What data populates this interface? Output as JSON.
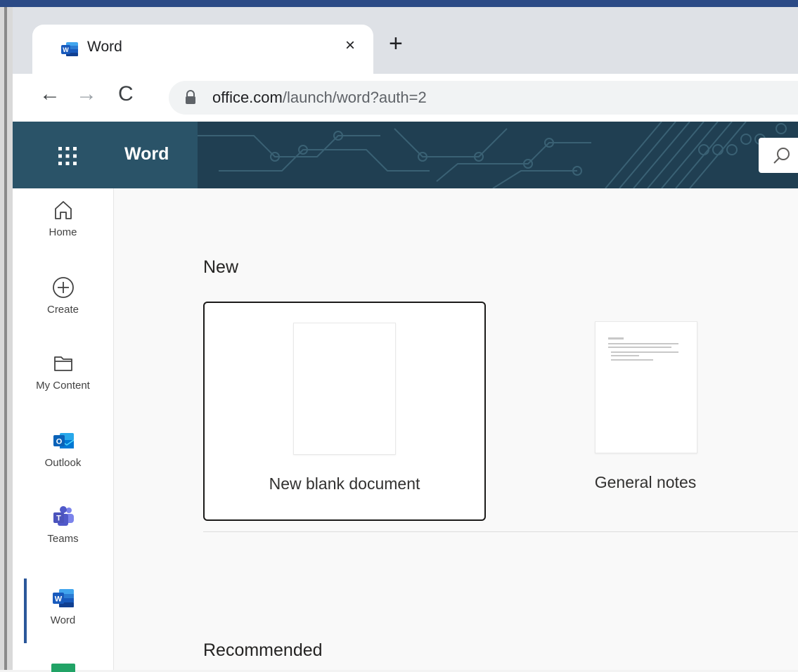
{
  "browser": {
    "tab_title": "Word",
    "close_glyph": "×",
    "new_tab_glyph": "+",
    "back_glyph": "←",
    "forward_glyph": "→",
    "reload_glyph": "C",
    "url_domain": "office.com",
    "url_path": "/launch/word?auth=2"
  },
  "header": {
    "app_title": "Word",
    "bg_color": "#203f52",
    "waffle_icon": "app-launcher-icon",
    "search_icon": "search-icon"
  },
  "rail": {
    "items": [
      {
        "label": "Home",
        "icon": "home-icon"
      },
      {
        "label": "Create",
        "icon": "plus-circle-icon"
      },
      {
        "label": "My Content",
        "icon": "folder-icon"
      },
      {
        "label": "Outlook",
        "icon": "outlook-icon"
      },
      {
        "label": "Teams",
        "icon": "teams-icon"
      },
      {
        "label": "Word",
        "icon": "word-icon",
        "active": true
      }
    ]
  },
  "main": {
    "new_section_title": "New",
    "templates": [
      {
        "label": "New blank document"
      },
      {
        "label": "General notes"
      }
    ],
    "recommended_title": "Recommended"
  }
}
